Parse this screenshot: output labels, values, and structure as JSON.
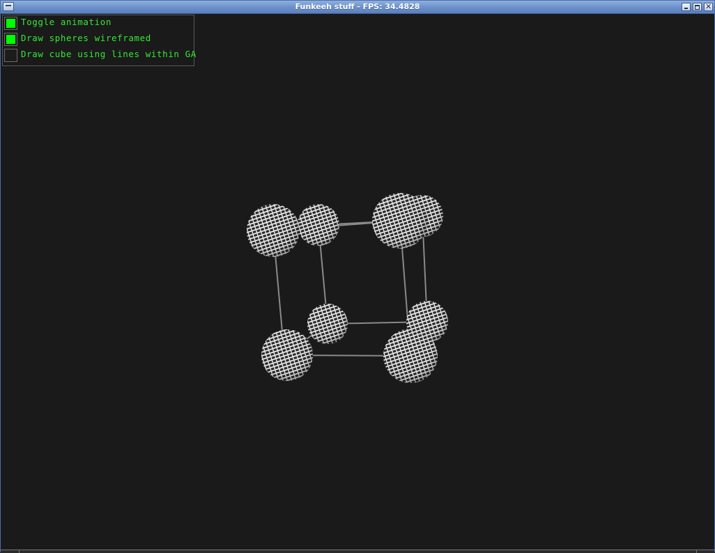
{
  "window": {
    "title": "Funkeeh stuff - FPS: 34.4828"
  },
  "options": [
    {
      "label": "Toggle animation",
      "checked": true
    },
    {
      "label": "Draw spheres wireframed",
      "checked": true
    },
    {
      "label": "Draw cube using lines within GA",
      "checked": false
    }
  ],
  "scene": {
    "background_color": "#1a1a1a",
    "checkbox_on_color": "#00ff00",
    "label_color": "#34e834",
    "sphere_color": "#ffffff",
    "edge_color": "#8a8a8a",
    "object": "wireframe-spheres-on-cube-vertices",
    "sphere_count": 8
  }
}
